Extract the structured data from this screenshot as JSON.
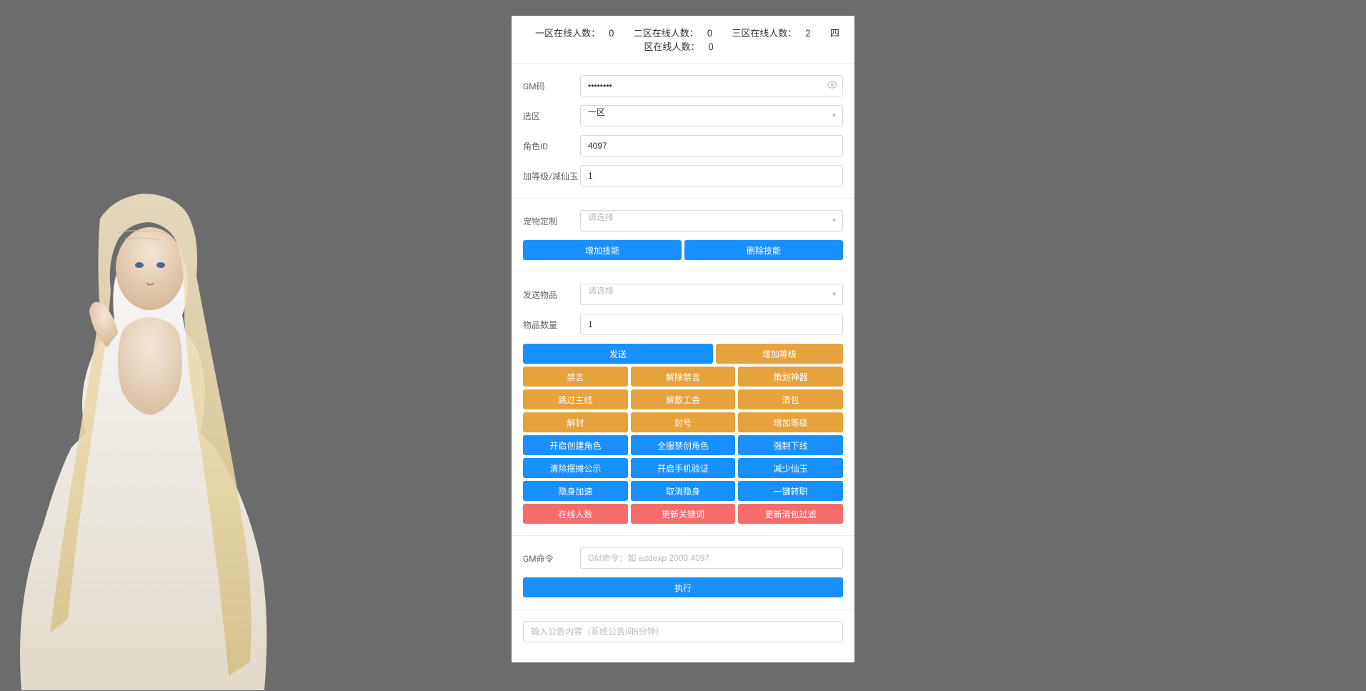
{
  "status": {
    "zone1_label": "一区在线人数：",
    "zone1_count": "0",
    "zone2_label": "二区在线人数：",
    "zone2_count": "0",
    "zone3_label": "三区在线人数：",
    "zone3_count": "2",
    "zone4_label": "四区在线人数：",
    "zone4_count": "0"
  },
  "form": {
    "gm_code_label": "GM码",
    "gm_code_value": "••••••••",
    "zone_label": "选区",
    "zone_value": "一区",
    "role_id_label": "角色ID",
    "role_id_value": "4097",
    "level_label": "加等级/减仙玉",
    "level_value": "1",
    "pet_label": "宠物定制",
    "pet_placeholder": "请选择",
    "send_item_label": "发送物品",
    "send_item_placeholder": "请选择",
    "item_count_label": "物品数量",
    "item_count_value": "1",
    "gm_cmd_label": "GM命令",
    "gm_cmd_placeholder": "GM命令：如 addexp 2000 4097",
    "announce_placeholder": "输入公告内容（系统公告间5分钟）"
  },
  "buttons": {
    "add_skill": "增加技能",
    "del_skill": "删除技能",
    "send": "发送",
    "add_level": "增加等级",
    "mute": "禁言",
    "unmute": "解除禁言",
    "plan_god": "策划神器",
    "skip_main": "跳过主线",
    "dissolve_guild": "解散工会",
    "clear_bag": "清包",
    "unseal": "解封",
    "seal": "封号",
    "add_level2": "增加等级",
    "enable_create": "开启创建角色",
    "disable_create": "全服禁创角色",
    "force_offline": "强制下线",
    "clear_display": "清除摆摊公示",
    "enable_phone": "开启手机验证",
    "reduce_jade": "减少仙玉",
    "stealth_speed": "隐身加速",
    "cancel_stealth": "取消隐身",
    "one_key_job": "一键转职",
    "online_count": "在线人数",
    "update_keyword": "更新关键词",
    "update_filter": "更新清包过滤",
    "execute": "执行"
  }
}
